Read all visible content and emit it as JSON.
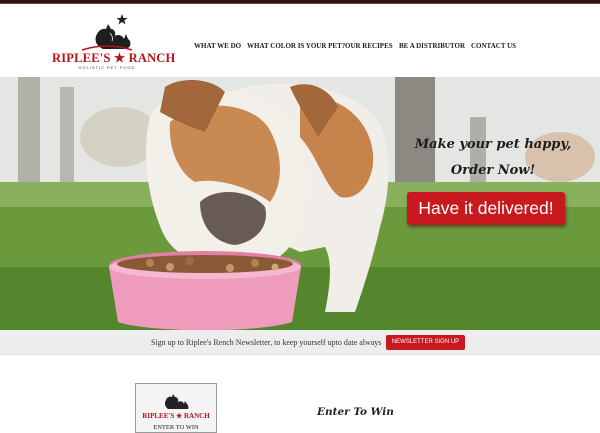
{
  "brand": {
    "name": "RIPLEE'S ★ RANCH",
    "subtitle": "HOLISTIC PET FOOD",
    "accent_color": "#c8191f",
    "icon": "dog-and-cat-logo-icon"
  },
  "nav": {
    "items": [
      {
        "label": "WHAT WE DO"
      },
      {
        "label": "WHAT COLOR IS YOUR PET?"
      },
      {
        "label": "OUR RECIPES"
      },
      {
        "label": "BE A DISTRIBUTOR"
      },
      {
        "label": "CONTACT US"
      }
    ]
  },
  "hero": {
    "tagline_line1": "Make your pet happy,",
    "tagline_line2": "Order Now!",
    "cta_label": "Have it delivered!"
  },
  "newsletter": {
    "text": "Sign up to Riplee's Rench Newsletter, to keep yourself upto date always",
    "button_label": "NEWSLETTER SIGN UP"
  },
  "contest": {
    "image_logo": "RIPLEE'S ★ RANCH",
    "image_caption": "ENTER TO WIN",
    "title": "Enter To Win"
  }
}
